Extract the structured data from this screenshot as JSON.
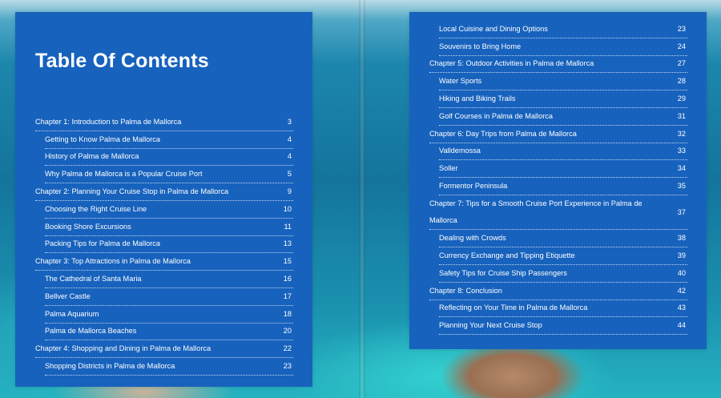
{
  "left_page": {
    "title": "Table Of Contents",
    "entries": [
      {
        "label": "Chapter 1: Introduction to Palma de Mallorca",
        "page": "3",
        "level": 0
      },
      {
        "label": "Getting to Know Palma de Mallorca",
        "page": "4",
        "level": 1
      },
      {
        "label": "History of Palma de Mallorca",
        "page": "4",
        "level": 1
      },
      {
        "label": "Why Palma de Mallorca is a Popular Cruise Port",
        "page": "5",
        "level": 1
      },
      {
        "label": "Chapter 2: Planning Your Cruise Stop in Palma de Mallorca",
        "page": "9",
        "level": 0
      },
      {
        "label": "Choosing the Right Cruise Line",
        "page": "10",
        "level": 1
      },
      {
        "label": "Booking Shore Excursions",
        "page": "11",
        "level": 1
      },
      {
        "label": "Packing Tips for Palma de Mallorca",
        "page": "13",
        "level": 1
      },
      {
        "label": "Chapter 3: Top Attractions in Palma de Mallorca",
        "page": "15",
        "level": 0
      },
      {
        "label": "The Cathedral of Santa Maria",
        "page": "16",
        "level": 1
      },
      {
        "label": "Bellver Castle",
        "page": "17",
        "level": 1
      },
      {
        "label": "Palma Aquarium",
        "page": "18",
        "level": 1
      },
      {
        "label": "Palma de Mallorca Beaches",
        "page": "20",
        "level": 1
      },
      {
        "label": "Chapter 4: Shopping and Dining in Palma de Mallorca",
        "page": "22",
        "level": 0
      },
      {
        "label": "Shopping Districts in Palma de Mallorca",
        "page": "23",
        "level": 1
      }
    ]
  },
  "right_page": {
    "entries": [
      {
        "label": "Local Cuisine and Dining Options",
        "page": "23",
        "level": 1
      },
      {
        "label": "Souvenirs to Bring Home",
        "page": "24",
        "level": 1
      },
      {
        "label": "Chapter 5: Outdoor Activities in Palma de Mallorca",
        "page": "27",
        "level": 0
      },
      {
        "label": "Water Sports",
        "page": "28",
        "level": 1
      },
      {
        "label": "Hiking and Biking Trails",
        "page": "29",
        "level": 1
      },
      {
        "label": "Golf Courses in Palma de Mallorca",
        "page": "31",
        "level": 1
      },
      {
        "label": "Chapter 6: Day Trips from Palma de Mallorca",
        "page": "32",
        "level": 0
      },
      {
        "label": "Valldemossa",
        "page": "33",
        "level": 1
      },
      {
        "label": "Soller",
        "page": "34",
        "level": 1
      },
      {
        "label": "Formentor Peninsula",
        "page": "35",
        "level": 1
      },
      {
        "label": "Chapter 7: Tips for a Smooth Cruise Port Experience in Palma de Mallorca",
        "page": "37",
        "level": 0
      },
      {
        "label": "Dealing with Crowds",
        "page": "38",
        "level": 1
      },
      {
        "label": "Currency Exchange and Tipping Etiquette",
        "page": "39",
        "level": 1
      },
      {
        "label": "Safety Tips for Cruise Ship Passengers",
        "page": "40",
        "level": 1
      },
      {
        "label": "Chapter 8: Conclusion",
        "page": "42",
        "level": 0
      },
      {
        "label": "Reflecting on Your Time in Palma de Mallorca",
        "page": "43",
        "level": 1
      },
      {
        "label": "Planning Your Next Cruise Stop",
        "page": "44",
        "level": 1
      }
    ]
  },
  "colors": {
    "panel": "#1762bd",
    "text": "#ffffff",
    "sea": "#1a7fa6"
  }
}
